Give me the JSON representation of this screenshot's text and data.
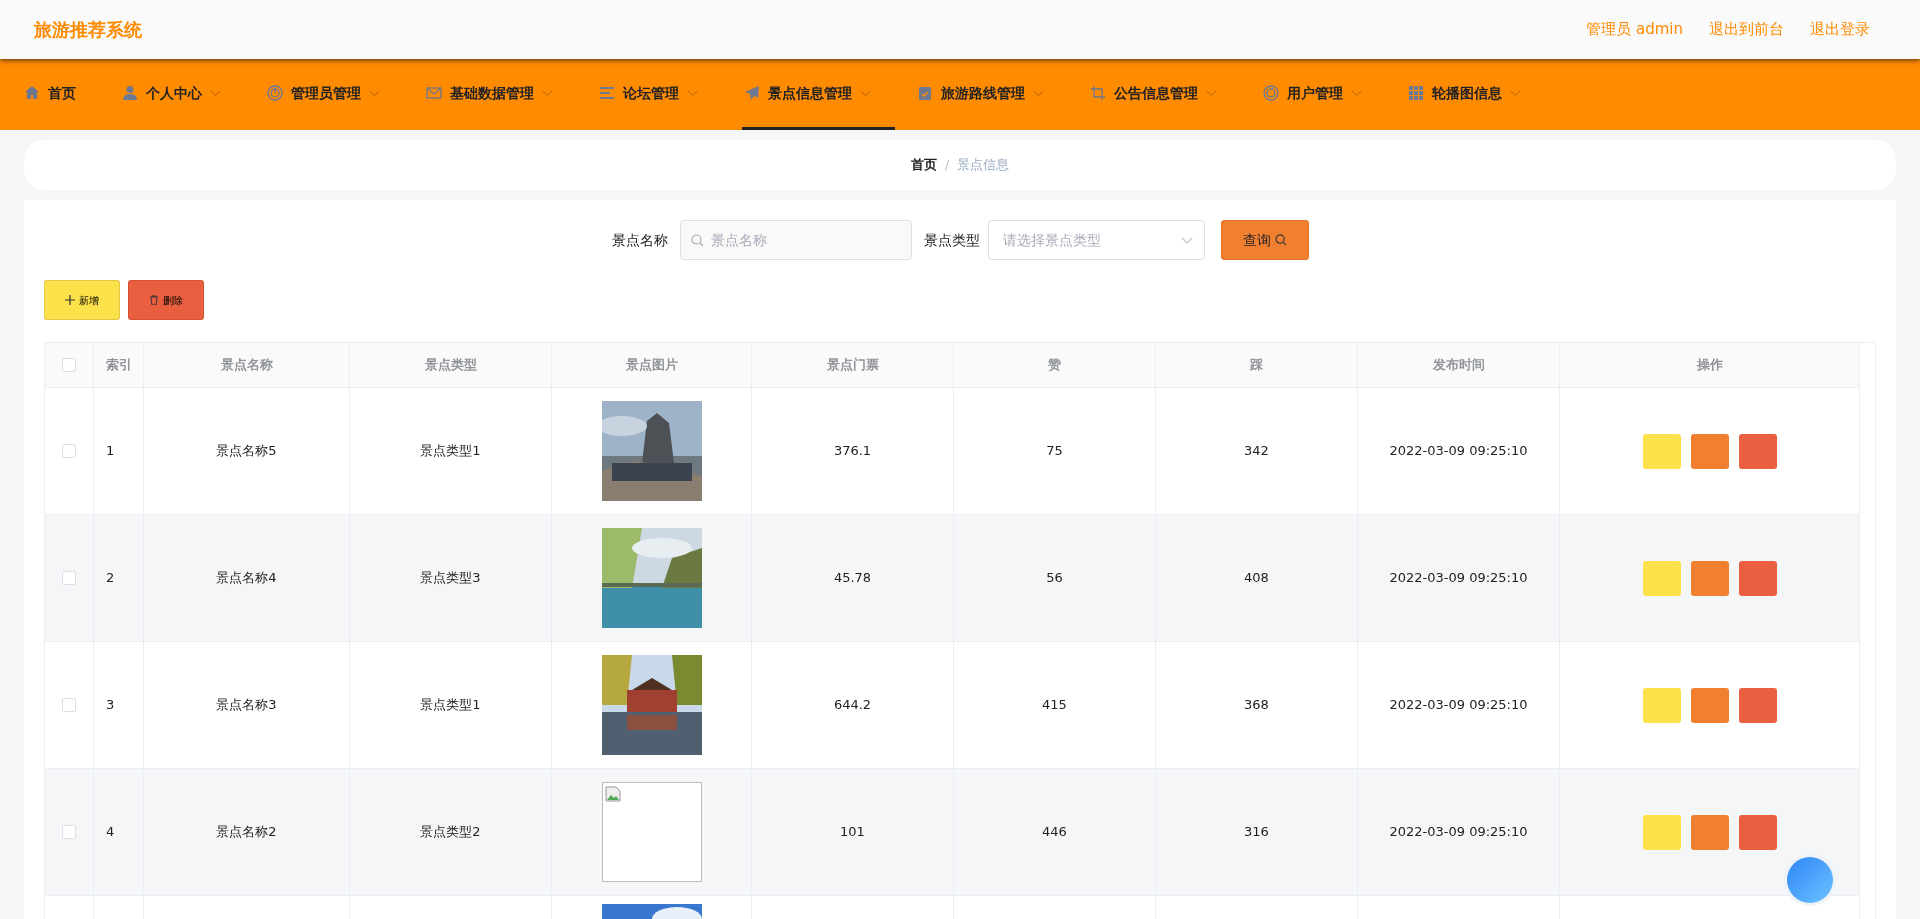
{
  "header": {
    "title": "旅游推荐系统",
    "links": [
      "管理员 admin",
      "退出到前台",
      "退出登录"
    ]
  },
  "nav": [
    {
      "label": "首页",
      "dropdown": false,
      "selected": false
    },
    {
      "label": "个人中心",
      "dropdown": true,
      "selected": false
    },
    {
      "label": "管理员管理",
      "dropdown": true,
      "selected": false
    },
    {
      "label": "基础数据管理",
      "dropdown": true,
      "selected": false
    },
    {
      "label": "论坛管理",
      "dropdown": true,
      "selected": false
    },
    {
      "label": "景点信息管理",
      "dropdown": true,
      "selected": true
    },
    {
      "label": "旅游路线管理",
      "dropdown": true,
      "selected": false
    },
    {
      "label": "公告信息管理",
      "dropdown": true,
      "selected": false
    },
    {
      "label": "用户管理",
      "dropdown": true,
      "selected": false
    },
    {
      "label": "轮播图信息",
      "dropdown": true,
      "selected": false
    }
  ],
  "breadcrumb": {
    "separator": "/",
    "items": [
      "首页",
      "景点信息"
    ]
  },
  "search": {
    "name_label": "景点名称",
    "name_placeholder": "景点名称",
    "type_label": "景点类型",
    "type_placeholder": "请选择景点类型",
    "button": "查询"
  },
  "actions": [
    "新增",
    "删除"
  ],
  "table": {
    "all_checked": false,
    "columns": [
      "索引",
      "景点名称",
      "景点类型",
      "景点图片",
      "景点门票",
      "赞",
      "踩",
      "发布时间",
      "操作"
    ],
    "rows": [
      {
        "index": "1",
        "name": "景点名称5",
        "type": "景点类型1",
        "image": {
          "kind": "picture"
        },
        "ticket": "376.1",
        "likes": "75",
        "dislikes": "342",
        "time": "2022-03-09 09:25:10",
        "checked": false
      },
      {
        "index": "2",
        "name": "景点名称4",
        "type": "景点类型3",
        "image": {
          "kind": "picture"
        },
        "ticket": "45.78",
        "likes": "56",
        "dislikes": "408",
        "time": "2022-03-09 09:25:10",
        "checked": false
      },
      {
        "index": "3",
        "name": "景点名称3",
        "type": "景点类型1",
        "image": {
          "kind": "picture"
        },
        "ticket": "644.2",
        "likes": "415",
        "dislikes": "368",
        "time": "2022-03-09 09:25:10",
        "checked": false
      },
      {
        "index": "4",
        "name": "景点名称2",
        "type": "景点类型2",
        "image": {
          "kind": "broken"
        },
        "ticket": "101",
        "likes": "446",
        "dislikes": "316",
        "time": "2022-03-09 09:25:10",
        "checked": false
      },
      {
        "image": {
          "kind": "picture"
        }
      }
    ]
  }
}
